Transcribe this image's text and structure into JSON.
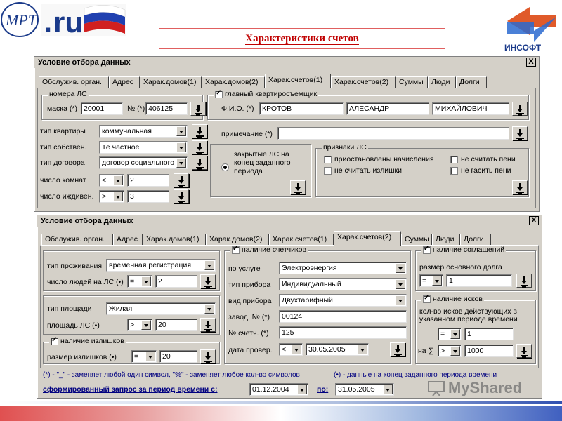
{
  "header": {
    "title": "Характеристики счетов",
    "logo_left_text": "ru",
    "logo_right_text": "ИНСОФТ"
  },
  "window1": {
    "title": "Условие отбора данных",
    "close": "X",
    "tabs": [
      "Обслужив. орган.",
      "Адрес",
      "Харак.домов(1)",
      "Харак.домов(2)",
      "Харак.счетов(1)",
      "Харак.счетов(2)",
      "Суммы",
      "Люди",
      "Долги"
    ],
    "active_tab": 4,
    "group_ls": {
      "title": "номера ЛС",
      "mask_label": "маска (*)",
      "mask_value": "20001",
      "num_label": "№ (*)",
      "num_value": "406125"
    },
    "main_tenant": {
      "title": "главный квартиросъемщик",
      "fio_label": "Ф.И.О. (*)",
      "last_name": "КРОТОВ",
      "first_name": "АЛЕСАНДР",
      "patronymic": "МИХАЙЛОВИЧ"
    },
    "apt_type_label": "тип квартиры",
    "apt_type_value": "коммунальная",
    "owner_type_label": "тип собствен.",
    "owner_type_value": "1е частное",
    "contract_type_label": "тип договора",
    "contract_type_value": "договор социального",
    "rooms_label": "число комнат",
    "rooms_op": "<",
    "rooms_value": "2",
    "dependents_label": "число иждивен.",
    "dependents_op": ">",
    "dependents_value": "3",
    "note_label": "примечание (*)",
    "note_value": "",
    "closed_ls": "закрытые ЛС на конец заданного периода",
    "signs": {
      "title": "признаки ЛС",
      "items": [
        "приостановлены начисления",
        "не считать пени",
        "не считать излишки",
        "не гасить пени"
      ]
    }
  },
  "window2": {
    "title": "Условие отбора данных",
    "close": "X",
    "tabs": [
      "Обслужив. орган.",
      "Адрес",
      "Харак.домов(1)",
      "Харак.домов(2)",
      "Харак.счетов(1)",
      "Харак.счетов(2)",
      "Суммы",
      "Люди",
      "Долги"
    ],
    "active_tab": 5,
    "residence_label": "тип проживания",
    "residence_value": "временная регистрация",
    "people_label": "число людей на ЛС (•)",
    "people_op": "=",
    "people_value": "2",
    "area_type_label": "тип площади",
    "area_type_value": "Жилая",
    "area_label": "площадь ЛС (•)",
    "area_op": ">",
    "area_value": "20",
    "surplus_title": "наличие излишков",
    "surplus_label": "размер излишков (•)",
    "surplus_op": "=",
    "surplus_value": "20",
    "meters": {
      "title": "наличие счетчиков",
      "service_label": "по услуге",
      "service_value": "Электроэнергия",
      "device_type_label": "тип прибора",
      "device_type_value": "Индивидуальный",
      "device_kind_label": "вид прибора",
      "device_kind_value": "Двухтарифный",
      "factory_label": "завод. № (*)",
      "factory_value": "00124",
      "meter_num_label": "№ счетч. (*)",
      "meter_num_value": "125",
      "check_date_label": "дата провер.",
      "check_date_op": "<",
      "check_date_value": "30.05.2005"
    },
    "agreements": {
      "title": "наличие соглашений",
      "debt_label": "размер основного долга",
      "debt_op": "=",
      "debt_value": "1"
    },
    "lawsuits": {
      "title": "наличие исков",
      "count_label": "кол-во исков действующих в указанном периоде времени",
      "count_op": "=",
      "count_value": "1",
      "sum_label": "на ∑",
      "sum_op": ">",
      "sum_value": "1000"
    },
    "legend": "(*) - \"_\" - заменяет любой один символ, \"%\" - заменяет любое кол-во символов",
    "legend_right": "(•) - данные на конец заданного периода времени",
    "query_label": "сформированный запрос за период времени с:",
    "date_from": "01.12.2004",
    "to_label": "по:",
    "date_to": "31.05.2005"
  },
  "watermark": "MyShared"
}
